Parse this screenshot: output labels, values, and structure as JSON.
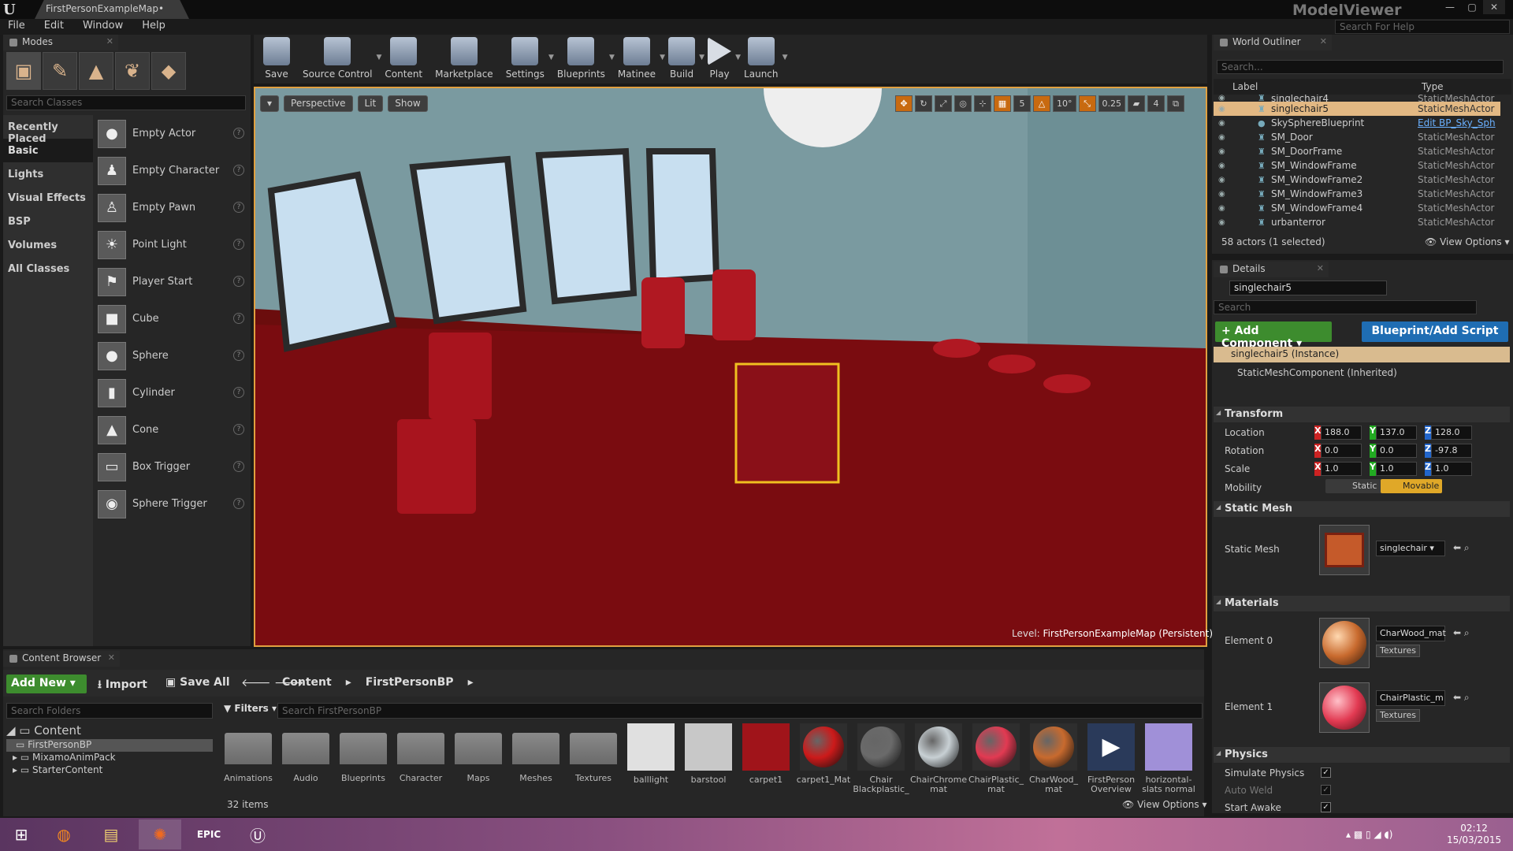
{
  "window": {
    "doc_tab": "FirstPersonExampleMap•",
    "app_name": "ModelViewer"
  },
  "menu": [
    "File",
    "Edit",
    "Window",
    "Help"
  ],
  "help_search_placeholder": "Search For Help",
  "modes": {
    "tab": "Modes",
    "search_placeholder": "Search Classes",
    "categories": [
      "Recently Placed",
      "Basic",
      "Lights",
      "Visual Effects",
      "BSP",
      "Volumes",
      "All Classes"
    ],
    "items": [
      "Empty Actor",
      "Empty Character",
      "Empty Pawn",
      "Point Light",
      "Player Start",
      "Cube",
      "Sphere",
      "Cylinder",
      "Cone",
      "Box Trigger",
      "Sphere Trigger"
    ]
  },
  "toolbar": [
    "Save",
    "Source Control",
    "Content",
    "Marketplace",
    "Settings",
    "Blueprints",
    "Matinee",
    "Build",
    "Play",
    "Launch"
  ],
  "viewport": {
    "perspective": "Perspective",
    "lit": "Lit",
    "show": "Show",
    "snap_angle": "10°",
    "snap_scale": "0.25",
    "camera_speed": "4",
    "grid": "5",
    "level_prefix": "Level:",
    "level_name": "FirstPersonExampleMap (Persistent)"
  },
  "outliner": {
    "tab": "World Outliner",
    "search_placeholder": "Search...",
    "col_label": "Label",
    "col_type": "Type",
    "rows": [
      {
        "label": "singlechair4",
        "type": "StaticMeshActor",
        "sel": false
      },
      {
        "label": "singlechair5",
        "type": "StaticMeshActor",
        "sel": true
      },
      {
        "label": "SkySphereBlueprint",
        "type": "Edit BP_Sky_Sph",
        "sel": false
      },
      {
        "label": "SM_Door",
        "type": "StaticMeshActor",
        "sel": false
      },
      {
        "label": "SM_DoorFrame",
        "type": "StaticMeshActor",
        "sel": false
      },
      {
        "label": "SM_WindowFrame",
        "type": "StaticMeshActor",
        "sel": false
      },
      {
        "label": "SM_WindowFrame2",
        "type": "StaticMeshActor",
        "sel": false
      },
      {
        "label": "SM_WindowFrame3",
        "type": "StaticMeshActor",
        "sel": false
      },
      {
        "label": "SM_WindowFrame4",
        "type": "StaticMeshActor",
        "sel": false
      },
      {
        "label": "urbanterror",
        "type": "StaticMeshActor",
        "sel": false
      }
    ],
    "footer": "58 actors (1 selected)",
    "view_options": "View Options"
  },
  "details": {
    "tab": "Details",
    "actor_name": "singlechair5",
    "search_placeholder": "Search",
    "add_component": "Add Component",
    "blueprint_script": "Blueprint/Add Script",
    "instance": "singlechair5 (Instance)",
    "component": "StaticMeshComponent (Inherited)",
    "transform": {
      "title": "Transform",
      "location_label": "Location",
      "rotation_label": "Rotation",
      "scale_label": "Scale",
      "mobility_label": "Mobility",
      "location": [
        "188.0",
        "137.0",
        "128.0"
      ],
      "rotation": [
        "0.0",
        "0.0",
        "-97.8"
      ],
      "scale": [
        "1.0",
        "1.0",
        "1.0"
      ],
      "static": "Static",
      "movable": "Movable"
    },
    "static_mesh": {
      "title": "Static Mesh",
      "label": "Static Mesh",
      "value": "singlechair"
    },
    "materials": {
      "title": "Materials",
      "elements": [
        {
          "label": "Element 0",
          "value": "CharWood_mat",
          "tex": "Textures",
          "color": "#c86a2e"
        },
        {
          "label": "Element 1",
          "value": "ChairPlastic_m",
          "tex": "Textures",
          "color": "#e23a52"
        }
      ]
    },
    "physics": {
      "title": "Physics",
      "simulate": "Simulate Physics",
      "autoweld": "Auto Weld",
      "start_awake": "Start Awake"
    }
  },
  "content_browser": {
    "tab": "Content Browser",
    "add_new": "Add New",
    "import": "Import",
    "save_all": "Save All",
    "path": [
      "Content",
      "FirstPersonBP"
    ],
    "folder_search_placeholder": "Search Folders",
    "tree": [
      "Content",
      "FirstPersonBP",
      "MixamoAnimPack",
      "StarterContent"
    ],
    "filters": "Filters",
    "asset_search_placeholder": "Search FirstPersonBP",
    "assets": [
      {
        "name": "Animations",
        "kind": "folder"
      },
      {
        "name": "Audio",
        "kind": "folder"
      },
      {
        "name": "Blueprints",
        "kind": "folder"
      },
      {
        "name": "Character",
        "kind": "folder"
      },
      {
        "name": "Maps",
        "kind": "folder"
      },
      {
        "name": "Meshes",
        "kind": "folder"
      },
      {
        "name": "Textures",
        "kind": "folder"
      },
      {
        "name": "balllight",
        "kind": "mesh",
        "color": "#e0e0e0"
      },
      {
        "name": "barstool",
        "kind": "mesh",
        "color": "#c8c8c8"
      },
      {
        "name": "carpet1",
        "kind": "tex",
        "color": "#a0141a"
      },
      {
        "name": "carpet1_Mat",
        "kind": "mat",
        "color": "#cc1a1a"
      },
      {
        "name": "Chair Blackplastic_",
        "kind": "mat",
        "color": "#6a6a6a"
      },
      {
        "name": "ChairChrome mat",
        "kind": "mat",
        "color": "#c8d0d4"
      },
      {
        "name": "ChairPlastic_ mat",
        "kind": "mat",
        "color": "#e23a52"
      },
      {
        "name": "CharWood_ mat",
        "kind": "mat",
        "color": "#c86a2e"
      },
      {
        "name": "FirstPerson Overview",
        "kind": "bp",
        "color": "#2a3a5a"
      },
      {
        "name": "horizontal- slats normal",
        "kind": "tex",
        "color": "#a090d8"
      }
    ],
    "count": "32 items",
    "view_options": "View Options"
  },
  "clock": {
    "time": "02:12",
    "date": "15/03/2015"
  }
}
